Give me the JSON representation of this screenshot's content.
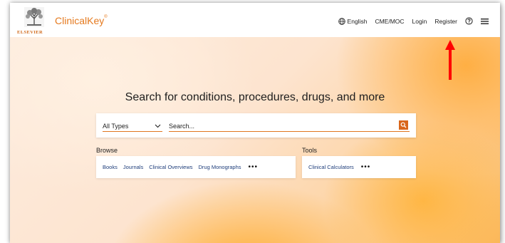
{
  "header": {
    "publisher": "ELSEVIER",
    "brand": "ClinicalKey",
    "brand_mark": "®",
    "nav": {
      "language": "English",
      "cme": "CME/MOC",
      "login": "Login",
      "register": "Register"
    }
  },
  "hero": {
    "headline": "Search for conditions, procedures, drugs, and more",
    "search": {
      "type_value": "All Types",
      "placeholder": "Search..."
    },
    "browse": {
      "label": "Browse",
      "links": [
        "Books",
        "Journals",
        "Clinical Overviews",
        "Drug Monographs"
      ],
      "more": "•••"
    },
    "tools": {
      "label": "Tools",
      "links": [
        "Clinical Calculators"
      ],
      "more": "•••"
    }
  },
  "colors": {
    "accent": "#e0761f",
    "link": "#1e3d7a",
    "annotation_arrow": "#ff0000"
  }
}
